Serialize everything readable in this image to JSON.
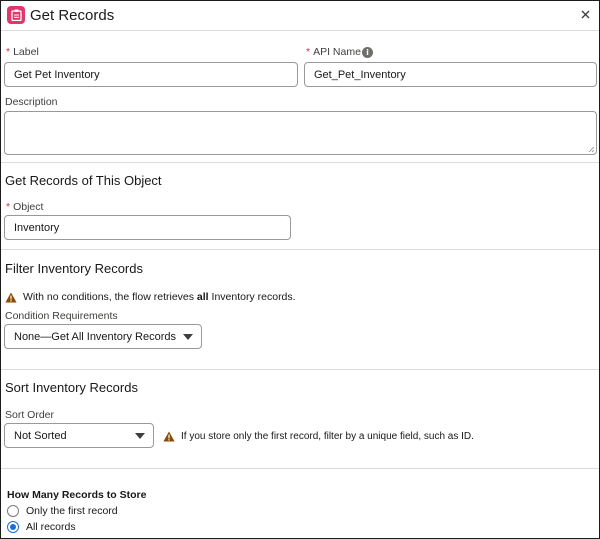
{
  "header": {
    "title": "Get Records",
    "icon": "clipboard-icon",
    "accent": "#e3366c"
  },
  "fields": {
    "label": {
      "text": "Label",
      "value": "Get Pet Inventory"
    },
    "api_name": {
      "text": "API Name",
      "value": "Get_Pet_Inventory"
    },
    "description": {
      "text": "Description",
      "value": ""
    }
  },
  "object_section": {
    "title": "Get Records of This Object",
    "object_label": "Object",
    "object_value": "Inventory"
  },
  "filter_section": {
    "title": "Filter Inventory Records",
    "warning_pre": "With no conditions, the flow retrieves",
    "warning_bold": "all",
    "warning_post": "Inventory records.",
    "condition_label": "Condition Requirements",
    "condition_value": "None—Get All Inventory Records"
  },
  "sort_section": {
    "title": "Sort Inventory Records",
    "order_label": "Sort Order",
    "order_value": "Not Sorted",
    "hint": "If you store only the first record, filter by a unique field, such as ID."
  },
  "store_section": {
    "title": "How Many Records to Store",
    "options": [
      {
        "label": "Only the first record",
        "selected": false
      },
      {
        "label": "All records",
        "selected": true
      }
    ]
  },
  "colors": {
    "required": "#c23934",
    "warning": "#8c4b02",
    "radio_selected": "#1b6ed6"
  }
}
